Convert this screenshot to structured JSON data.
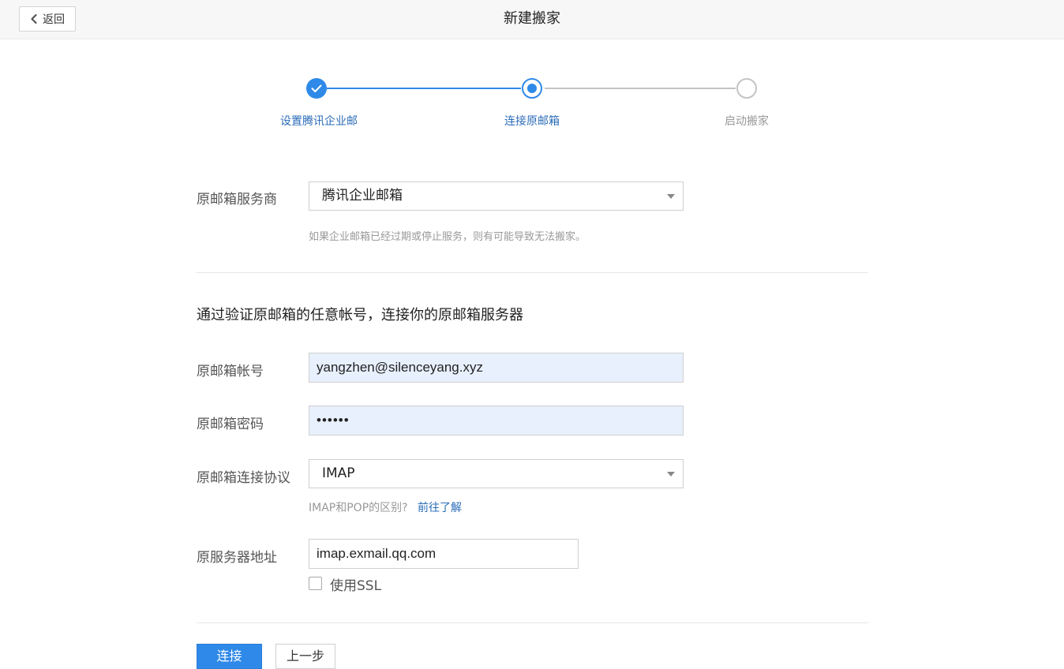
{
  "header": {
    "back_label": "返回",
    "title": "新建搬家"
  },
  "stepper": {
    "steps": [
      {
        "label": "设置腾讯企业邮",
        "state": "done"
      },
      {
        "label": "连接原邮箱",
        "state": "active"
      },
      {
        "label": "启动搬家",
        "state": "pending"
      }
    ],
    "colors": {
      "active": "#2f89e8",
      "pending": "#c4c4c4",
      "pending_text": "#999999"
    }
  },
  "provider": {
    "label": "原邮箱服务商",
    "value": "腾讯企业邮箱",
    "hint": "如果企业邮箱已经过期或停止服务，则有可能导致无法搬家。"
  },
  "connect": {
    "section_title": "通过验证原邮箱的任意帐号，连接你的原邮箱服务器",
    "account_label": "原邮箱帐号",
    "account_value": "yangzhen@silenceyang.xyz",
    "password_label": "原邮箱密码",
    "password_value": "••••••",
    "protocol_label": "原邮箱连接协议",
    "protocol_value": "IMAP",
    "protocol_hint": "IMAP和POP的区别?",
    "protocol_link": "前往了解",
    "server_label": "原服务器地址",
    "server_value": "imap.exmail.qq.com",
    "ssl_label": "使用SSL",
    "ssl_checked": false
  },
  "actions": {
    "connect_label": "连接",
    "prev_label": "上一步"
  }
}
